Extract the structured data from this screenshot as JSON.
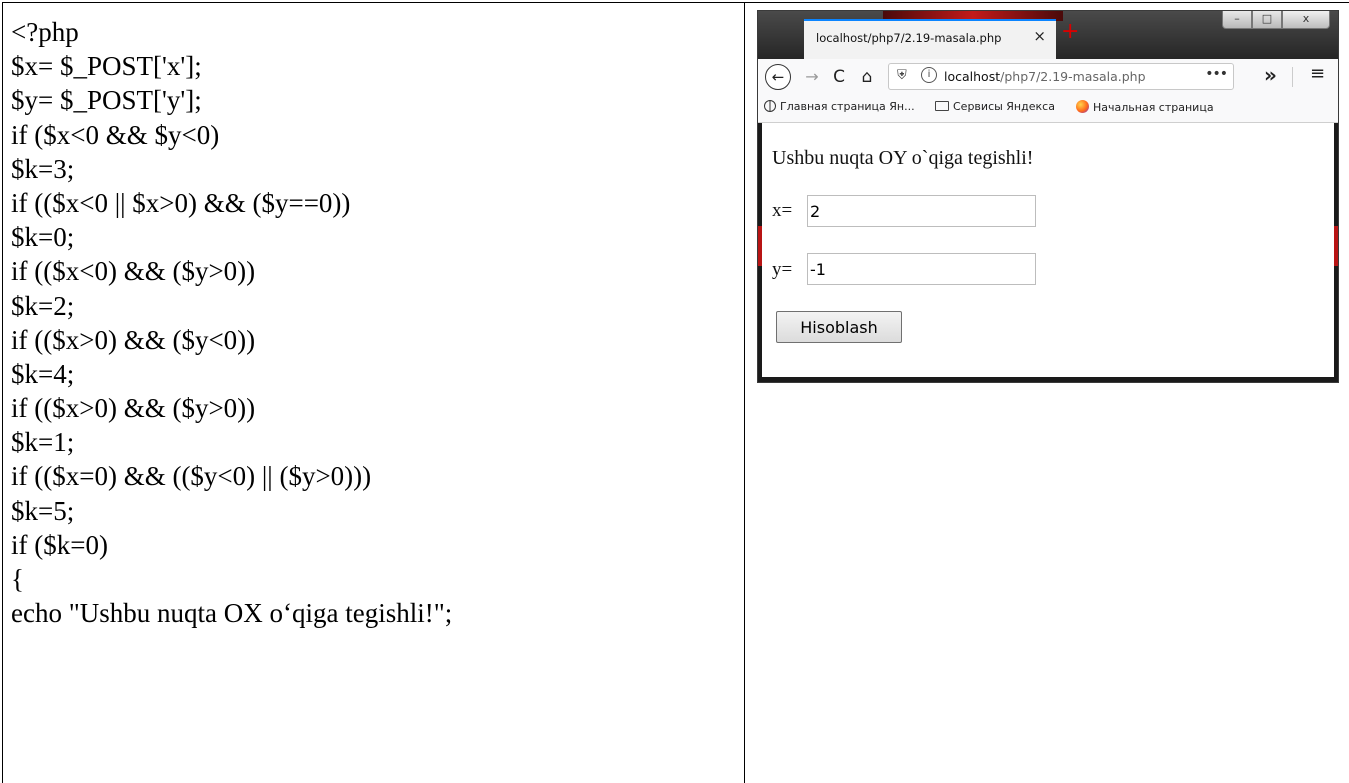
{
  "code": {
    "lines": [
      "<?php",
      "$x= $_POST['x'];",
      "$y= $_POST['y'];",
      "if ($x<0 && $y<0)",
      "$k=3;",
      "if (($x<0 || $x>0) && ($y==0))",
      "$k=0;",
      "if (($x<0) && ($y>0))",
      "$k=2;",
      "if (($x>0) && ($y<0))",
      "$k=4;",
      "if (($x>0) && ($y>0))",
      "$k=1;",
      "if (($x=0) && (($y<0) || ($y>0)))",
      "$k=5;",
      "if ($k=0)",
      "{",
      "echo \"Ushbu nuqta OX o‘qiga tegishli!\";"
    ]
  },
  "browser": {
    "tab_title": "localhost/php7/2.19-masala.php",
    "tab_close": "×",
    "new_tab": "+",
    "window_controls": {
      "minimize": "–",
      "maximize": "□",
      "close": "x"
    },
    "nav": {
      "back": "←",
      "forward": "→",
      "reload": "C",
      "home": "⌂"
    },
    "url_host": "localhost",
    "url_path": "/php7/2.19-masala.php",
    "url_dots": "•••",
    "overflow": "»",
    "menu": "≡",
    "bookmarks": [
      {
        "label": "Главная страница Ян...",
        "icon": "globe-icon"
      },
      {
        "label": "Сервисы Яндекса",
        "icon": "folder-icon"
      },
      {
        "label": "Начальная страница",
        "icon": "firefox-icon"
      }
    ]
  },
  "page": {
    "result_text": "Ushbu nuqta OY o`qiga tegishli!",
    "x_label": "x=",
    "x_value": "2",
    "y_label": "y=",
    "y_value": "-1",
    "submit_label": "Hisoblash"
  }
}
